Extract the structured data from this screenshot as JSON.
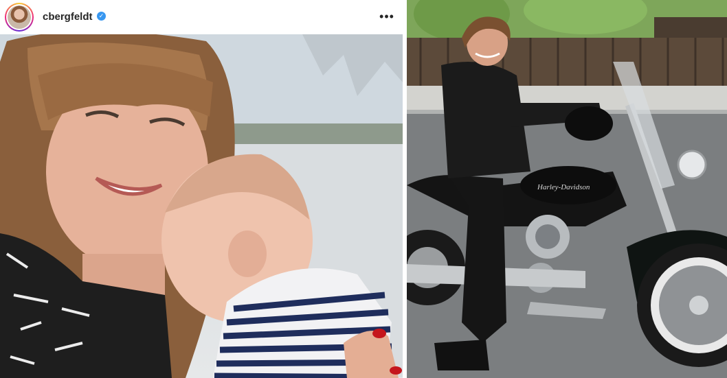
{
  "post": {
    "username": "cbergfeldt",
    "verified_icon": "verified-badge-icon",
    "more_icon": "more-options-icon",
    "more_glyph": "•••"
  },
  "colors": {
    "verified_blue": "#3897f0",
    "text_dark": "#262626"
  }
}
